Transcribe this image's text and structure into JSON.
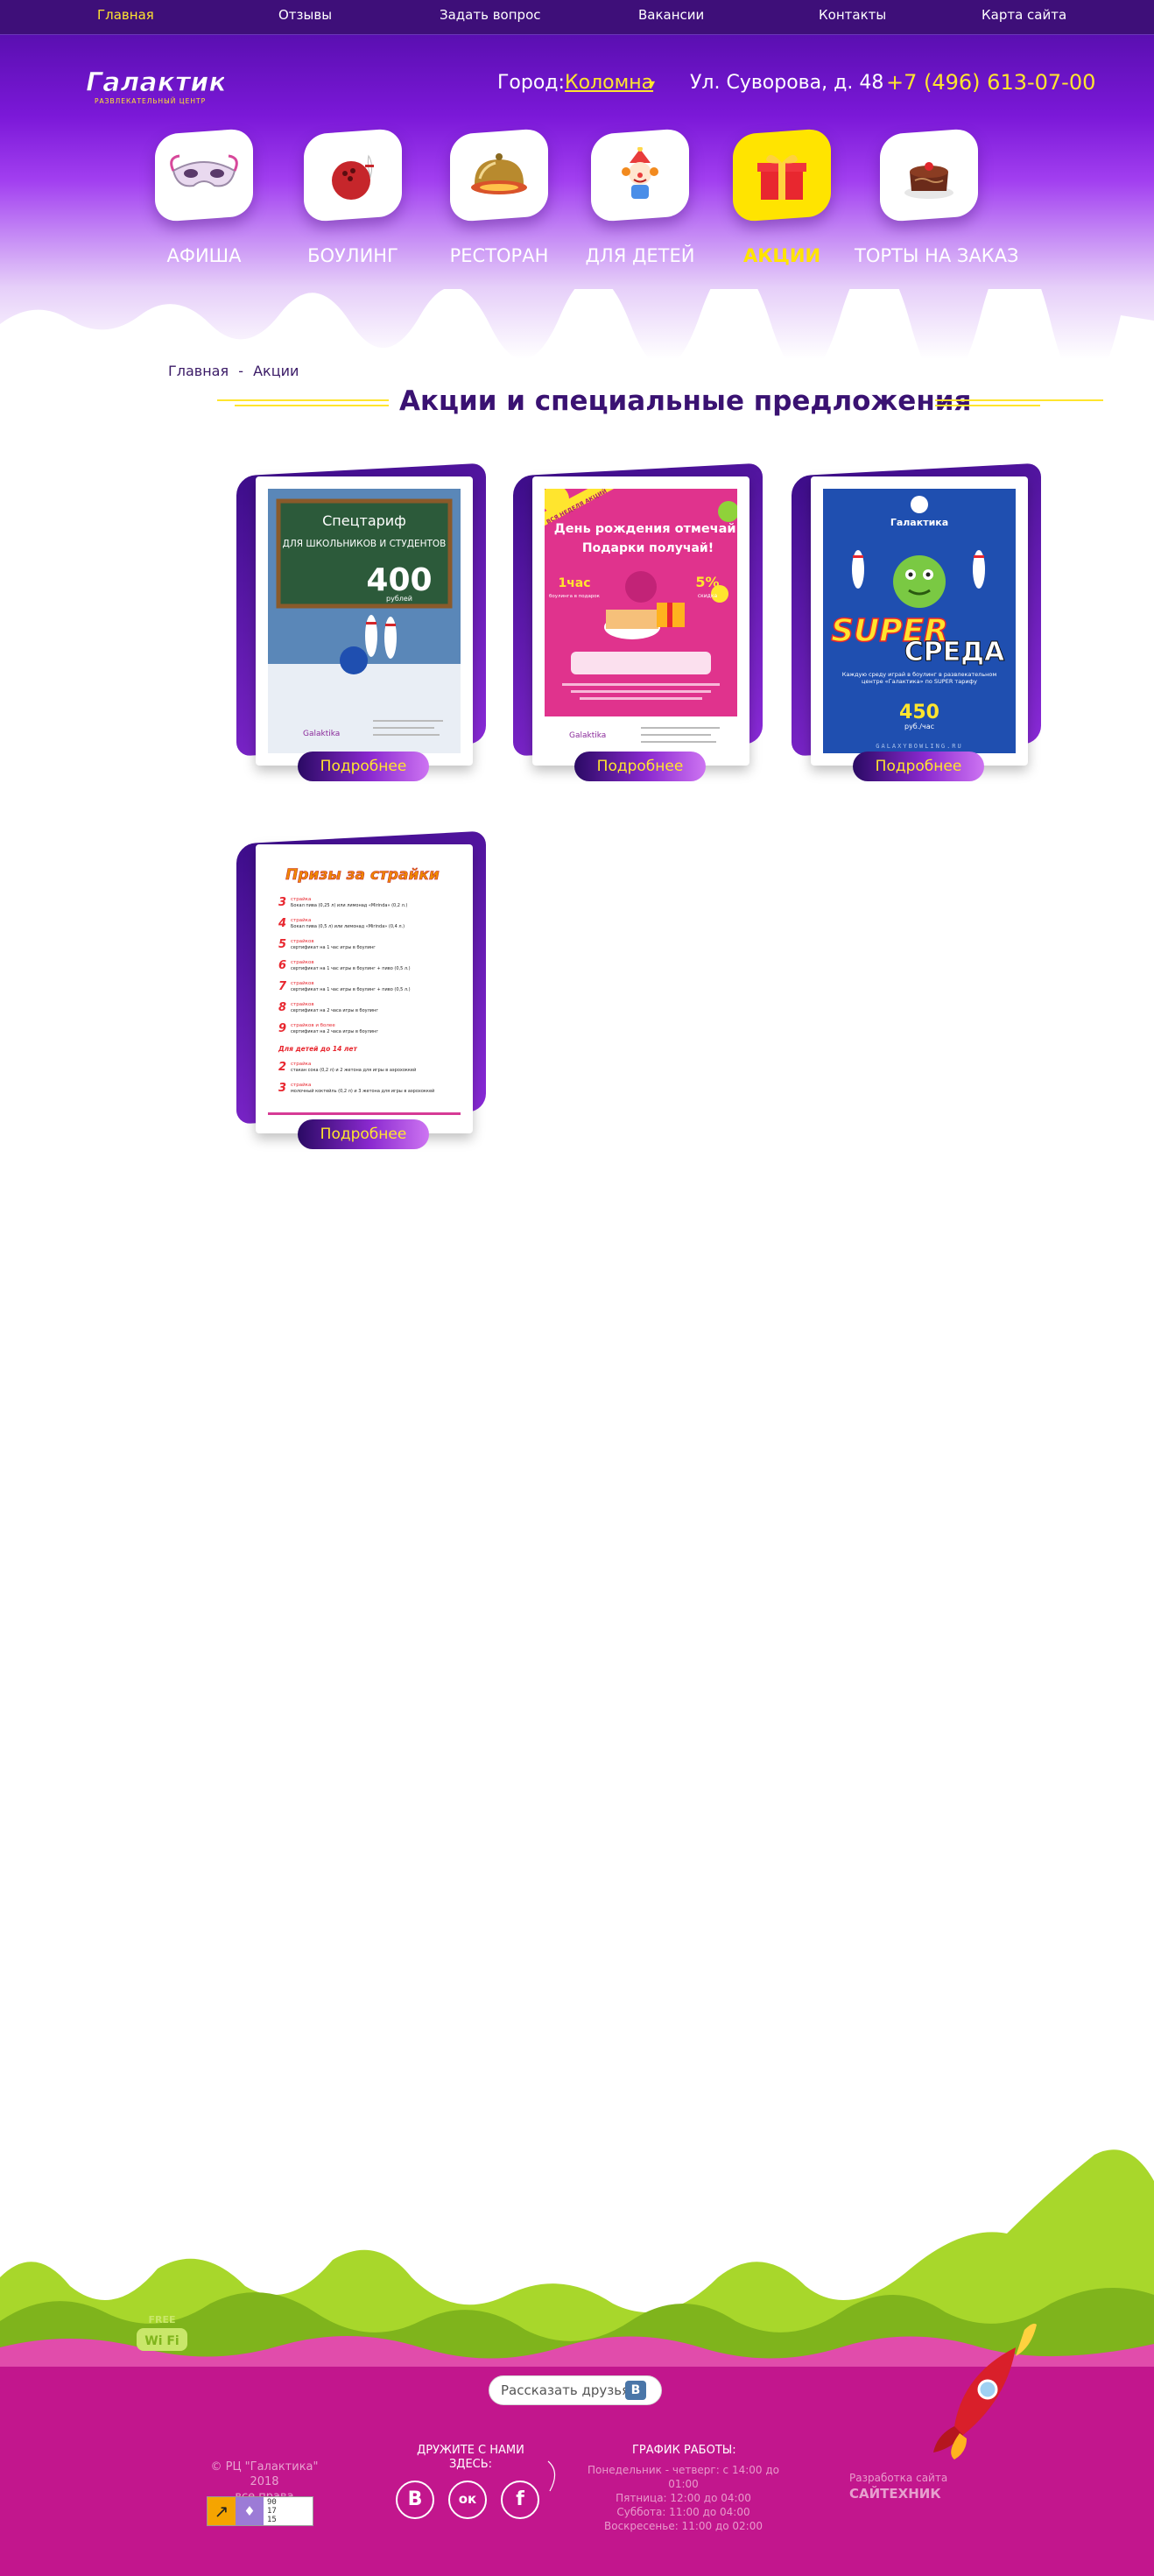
{
  "top_nav": {
    "items": [
      {
        "label": "Главная",
        "active": true
      },
      {
        "label": "Отзывы",
        "active": false
      },
      {
        "label": "Задать вопрос",
        "active": false
      },
      {
        "label": "Вакансии",
        "active": false
      },
      {
        "label": "Контакты",
        "active": false
      },
      {
        "label": "Карта сайта",
        "active": false
      }
    ]
  },
  "header": {
    "logo_text": "Галактика",
    "logo_subtitle": "РАЗВЛЕКАТЕЛЬНЫЙ ЦЕНТР",
    "city_label": "Город:",
    "city_value": "Коломна",
    "city_caret": "▾",
    "address": "Ул. Суворова, д. 48",
    "phone": "+7 (496) 613-07-00"
  },
  "categories": [
    {
      "label": "АФИША",
      "icon": "mask-icon",
      "active": false
    },
    {
      "label": "БОУЛИНГ",
      "icon": "bowling-icon",
      "active": false
    },
    {
      "label": "РЕСТОРАН",
      "icon": "restaurant-cloche-icon",
      "active": false
    },
    {
      "label": "ДЛЯ ДЕТЕЙ",
      "icon": "clown-icon",
      "active": false
    },
    {
      "label": "АКЦИИ",
      "icon": "gift-icon",
      "active": true
    },
    {
      "label": "ТОРТЫ НА ЗАКАЗ",
      "icon": "cake-icon",
      "active": false
    }
  ],
  "breadcrumb": {
    "home": "Главная",
    "separator": "-",
    "current": "Акции"
  },
  "page_title": "Акции и специальные предложения",
  "promos": [
    {
      "button": "Подробнее",
      "poster": {
        "headline": "Спецтариф",
        "subline": "ДЛЯ ШКОЛЬНИКОВ И СТУДЕНТОВ",
        "price": "400",
        "price_unit": "рублей",
        "brand": "Galaktika"
      }
    },
    {
      "button": "Подробнее",
      "poster": {
        "ribbon": "ВСЯ НЕДЕЛЯ АКЦИЙ",
        "headline": "День рождения отмечай!",
        "subline": "Подарки получай!",
        "left_badge": "1час",
        "left_badge_sub": "боулинга в подарок",
        "right_badge": "5%",
        "right_badge_sub": "скидка",
        "brand": "Galaktika"
      }
    },
    {
      "button": "Подробнее",
      "poster": {
        "brand": "Галактика",
        "headline": "SUPER",
        "subline": "СРЕДА",
        "note": "Каждую среду играй в боулинг в развлекательном центре «Галактика» по SUPER тарифу",
        "price": "450",
        "price_unit": "руб./час",
        "site": "GALAXYBOWLING.RU"
      }
    },
    {
      "button": "Подробнее",
      "poster": {
        "headline": "Призы за страйки",
        "rows": [
          {
            "num": "3",
            "title": "страйка",
            "text": "Бокал пива (0,25 л) или лимонад «Mirinda» (0,2 л.)"
          },
          {
            "num": "4",
            "title": "страйка",
            "text": "Бокал пива (0,5 л) или лимонад «Mirinda» (0,4 л.)"
          },
          {
            "num": "5",
            "title": "страйков",
            "text": "сертификат на 1 час игры в боулинг"
          },
          {
            "num": "6",
            "title": "страйков",
            "text": "сертификат на 1 час игры в боулинг + пиво (0,5 л.)"
          },
          {
            "num": "7",
            "title": "страйков",
            "text": "сертификат на 1 час игры в боулинг + пиво (0,5 л.)"
          },
          {
            "num": "8",
            "title": "страйков",
            "text": "сертификат на 2 часа игры в боулинг"
          },
          {
            "num": "9",
            "title": "страйков и более",
            "text": "сертификат на 2 часа игры в боулинг"
          }
        ],
        "kids_title": "Для детей до 14 лет",
        "kids_rows": [
          {
            "num": "2",
            "title": "страйка",
            "text": "стакан сока (0,2 л) и 2 жетона для игры в аэрохоккей"
          },
          {
            "num": "3",
            "title": "страйка",
            "text": "молочный коктейль (0,2 л) и 3 жетона для игры в аэрохоккей"
          }
        ]
      }
    }
  ],
  "footer": {
    "share_label": "Рассказать друзьям:",
    "share_icon": "vk-icon",
    "wifi_label_top": "FREE",
    "wifi_label": "Wi Fi",
    "copyright": "© РЦ \"Галактика\" 2018",
    "rights": "все права защищены",
    "counter_values": [
      "90",
      "17",
      "15"
    ],
    "friends_title": "ДРУЖИТЕ С НАМИ ЗДЕСЬ:",
    "socials": [
      {
        "name": "vk",
        "glyph": "B"
      },
      {
        "name": "odnoklassniki",
        "glyph": "ок"
      },
      {
        "name": "facebook",
        "glyph": "f"
      }
    ],
    "hours_title": "ГРАФИК РАБОТЫ:",
    "hours": [
      "Понедельник - четверг: с 14:00 до 01:00",
      "Пятница: 12:00 до 04:00",
      "Суббота: 11:00 до 04:00",
      "Воскресенье: 11:00 до 02:00"
    ],
    "dev_label": "Разработка сайта",
    "dev_name": "САЙТЕХНИК"
  },
  "colors": {
    "header_purple": "#3e0f79",
    "accent_yellow": "#ffe52e",
    "footer_magenta": "#c2168d",
    "hills_green": "#a8d72b"
  }
}
